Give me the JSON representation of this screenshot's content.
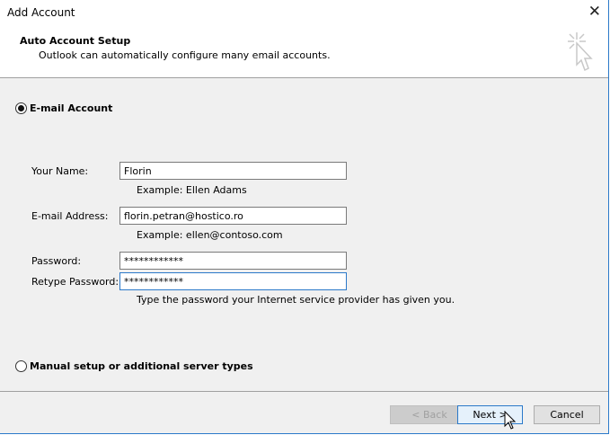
{
  "window": {
    "title": "Add Account"
  },
  "header": {
    "title": "Auto Account Setup",
    "subtitle": "Outlook can automatically configure many email accounts.",
    "icon": "wizard-cursor-icon"
  },
  "options": {
    "email_account": {
      "label": "E-mail Account",
      "selected": true
    },
    "manual": {
      "label": "Manual setup or additional server types",
      "selected": false
    }
  },
  "form": {
    "name": {
      "label": "Your Name:",
      "value": "Florin",
      "hint": "Example: Ellen Adams"
    },
    "email": {
      "label": "E-mail Address:",
      "value": "florin.petran@hostico.ro",
      "hint": "Example: ellen@contoso.com"
    },
    "password": {
      "label": "Password:",
      "value": "************"
    },
    "retype": {
      "label": "Retype Password:",
      "value": "************",
      "hint": "Type the password your Internet service provider has given you."
    }
  },
  "buttons": {
    "back": "< Back",
    "next": "Next >",
    "cancel": "Cancel"
  }
}
